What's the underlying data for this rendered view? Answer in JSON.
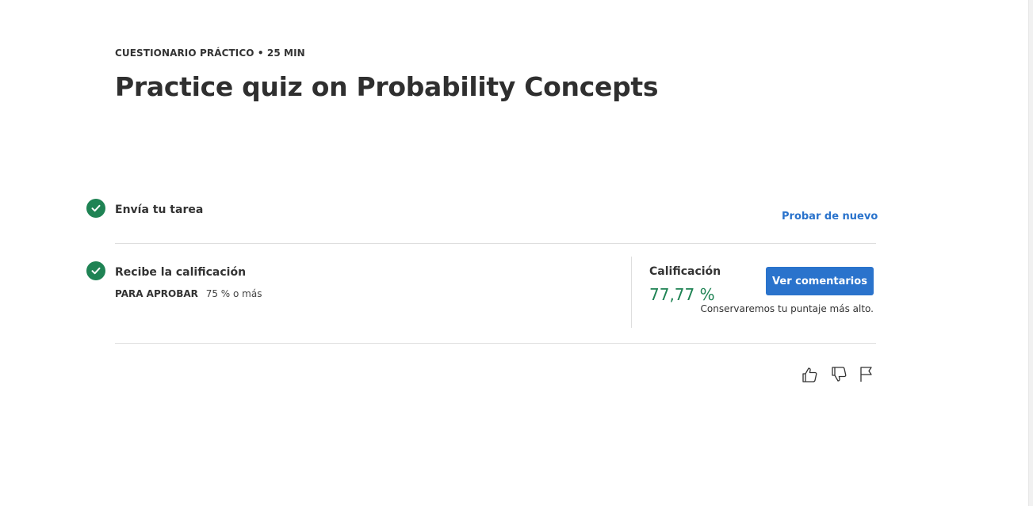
{
  "header": {
    "eyebrow": "CUESTIONARIO PRÁCTICO • 25 MIN",
    "title": "Practice quiz on Probability Concepts"
  },
  "steps": [
    {
      "label": "Envía tu tarea",
      "status": "complete",
      "action": "Probar de nuevo"
    },
    {
      "label": "Recibe la calificación",
      "status": "complete",
      "pass_key": "PARA APROBAR",
      "pass_value": "75 % o más"
    }
  ],
  "grade": {
    "label": "Calificación",
    "value": "77,77 %",
    "button": "Ver comentarios",
    "note": "Conservaremos tu puntaje más alto."
  },
  "feedback": {
    "icons": [
      "thumbs-up-icon",
      "thumbs-down-icon",
      "flag-icon"
    ]
  },
  "colors": {
    "accent": "#2a73cc",
    "success": "#1f8354"
  }
}
